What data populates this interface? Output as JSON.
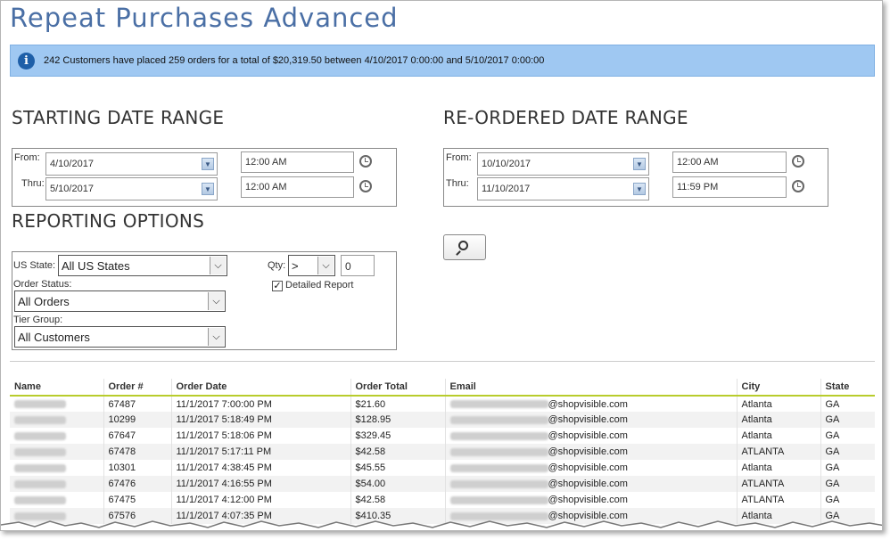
{
  "page": {
    "title": "Repeat Purchases Advanced"
  },
  "info_banner": {
    "icon": "info-icon",
    "text": "242 Customers have placed 259 orders for a total of $20,319.50 between 4/10/2017 0:00:00 and 5/10/2017 0:00:00"
  },
  "starting_range": {
    "heading": "STARTING DATE RANGE",
    "from_label": "From:",
    "thru_label": "Thru:",
    "from_date": "4/10/2017",
    "thru_date": "5/10/2017",
    "from_time": "12:00 AM",
    "thru_time": "12:00 AM"
  },
  "reordered_range": {
    "heading": "RE-ORDERED DATE RANGE",
    "from_label": "From:",
    "thru_label": "Thru:",
    "from_date": "10/10/2017",
    "thru_date": "11/10/2017",
    "from_time": "12:00 AM",
    "thru_time": "11:59 PM"
  },
  "reporting": {
    "heading": "REPORTING OPTIONS",
    "us_state_label": "US State:",
    "us_state_value": "All US States",
    "order_status_label": "Order Status:",
    "order_status_value": "All Orders",
    "tier_group_label": "Tier Group:",
    "tier_group_value": "All Customers",
    "qty_label": "Qty:",
    "qty_operator": ">",
    "qty_value": "0",
    "detailed_report_label": "Detailed Report",
    "detailed_report_checked": true
  },
  "table": {
    "columns": [
      "Name",
      "Order #",
      "Order Date",
      "Order Total",
      "Email",
      "City",
      "State"
    ],
    "rows": [
      {
        "order": "67487",
        "date": "11/1/2017 7:00:00 PM",
        "total": "$21.60",
        "email_domain": "@shopvisible.com",
        "city": "Atlanta",
        "state": "GA"
      },
      {
        "order": "10299",
        "date": "11/1/2017 5:18:49 PM",
        "total": "$128.95",
        "email_domain": "@shopvisible.com",
        "city": "Atlanta",
        "state": "GA"
      },
      {
        "order": "67647",
        "date": "11/1/2017 5:18:06 PM",
        "total": "$329.45",
        "email_domain": "@shopvisible.com",
        "city": "Atlanta",
        "state": "GA"
      },
      {
        "order": "67478",
        "date": "11/1/2017 5:17:11 PM",
        "total": "$42.58",
        "email_domain": "@shopvisible.com",
        "city": "ATLANTA",
        "state": "GA"
      },
      {
        "order": "10301",
        "date": "11/1/2017 4:38:45 PM",
        "total": "$45.55",
        "email_domain": "@shopvisible.com",
        "city": "Atlanta",
        "state": "GA"
      },
      {
        "order": "67476",
        "date": "11/1/2017 4:16:55 PM",
        "total": "$54.00",
        "email_domain": "@shopvisible.com",
        "city": "ATLANTA",
        "state": "GA"
      },
      {
        "order": "67475",
        "date": "11/1/2017 4:12:00 PM",
        "total": "$42.58",
        "email_domain": "@shopvisible.com",
        "city": "ATLANTA",
        "state": "GA"
      },
      {
        "order": "67576",
        "date": "11/1/2017 4:07:35 PM",
        "total": "$410.35",
        "email_domain": "@shopvisible.com",
        "city": "Atlanta",
        "state": "GA"
      }
    ]
  },
  "colors": {
    "title": "#4a6fa5",
    "banner": "#9fc8f2",
    "header_rule": "#b8cc2c"
  }
}
